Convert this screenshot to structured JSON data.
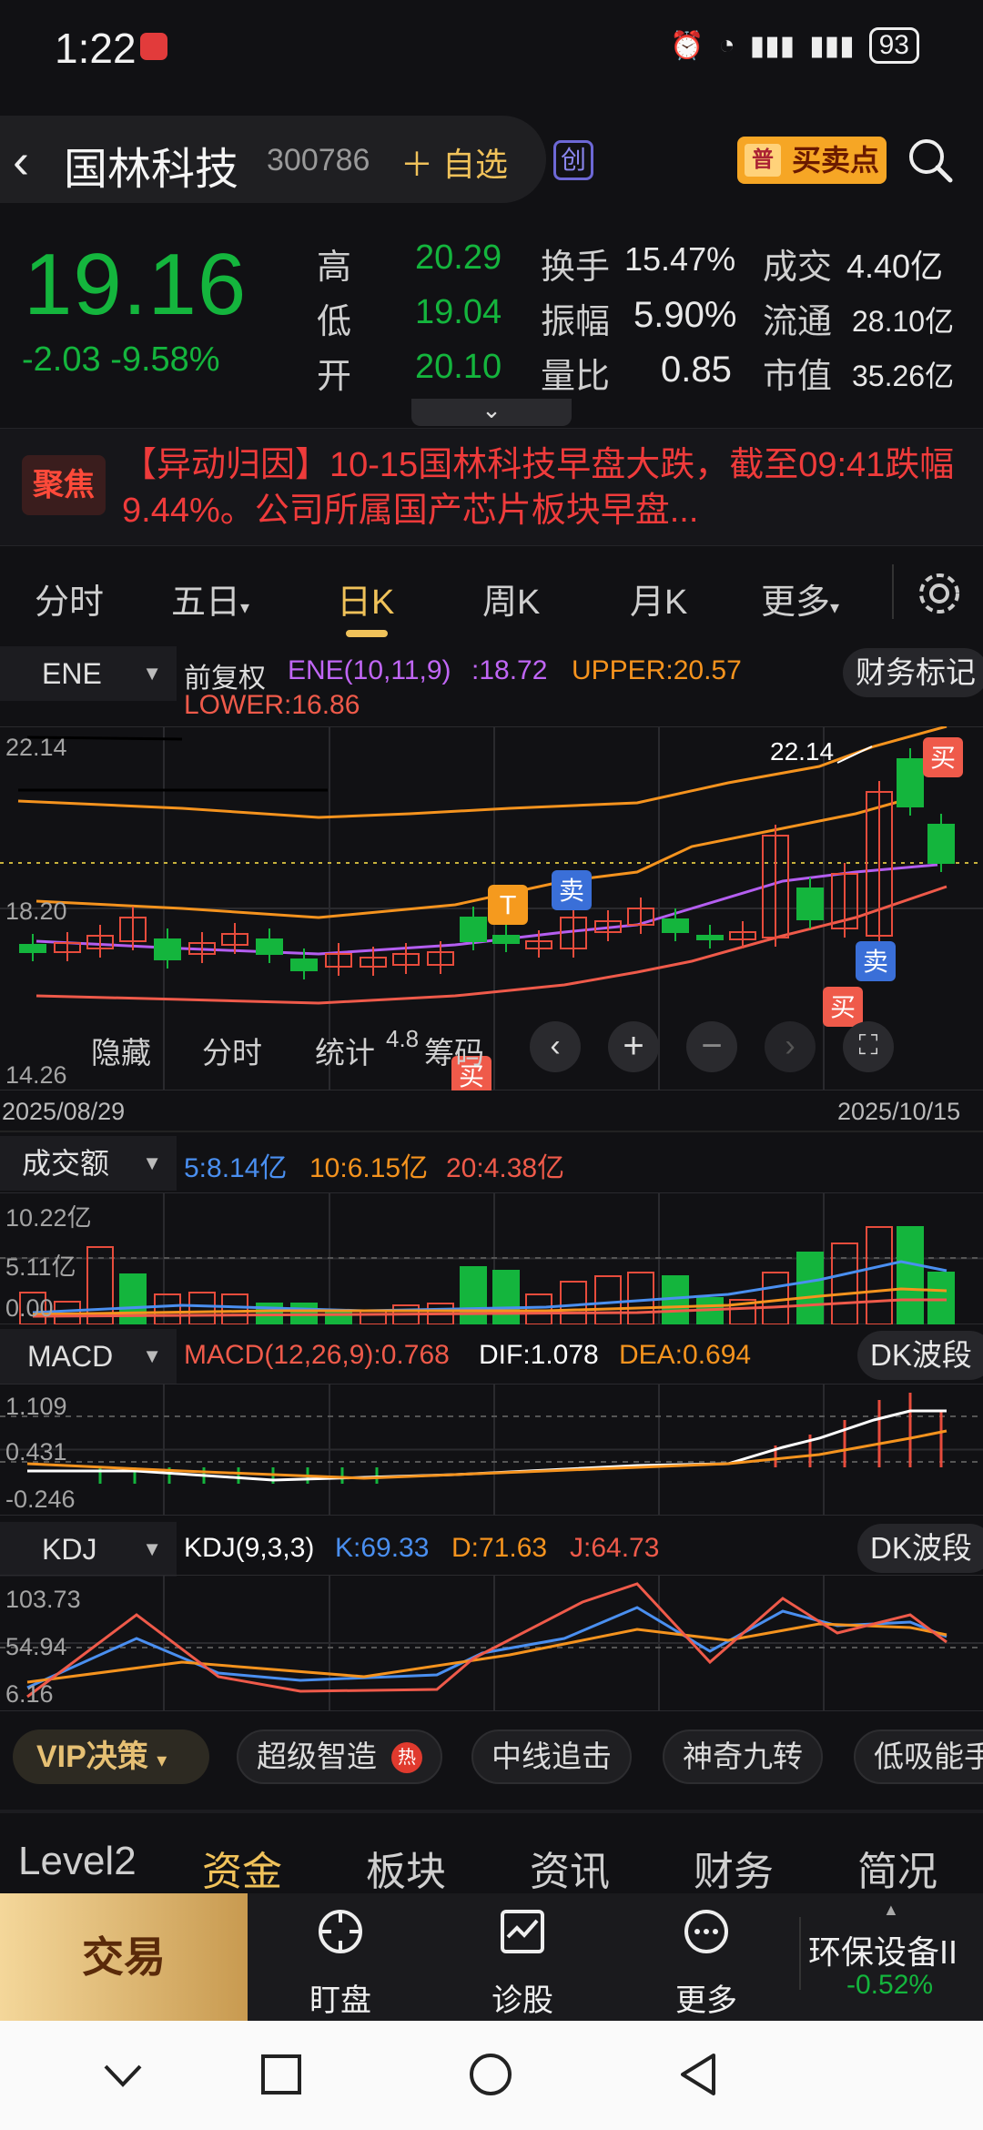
{
  "status_bar": {
    "time": "1:22",
    "battery": "93"
  },
  "header": {
    "stock_name": "国林科技",
    "stock_code": "300786",
    "add_favorite": "自选",
    "board_badge": "创",
    "buy_sell_points": "买卖点",
    "buy_sell_badge": "普"
  },
  "quote": {
    "price": "19.16",
    "change": "-2.03",
    "change_pct": "-9.58%",
    "high_label": "高",
    "high": "20.29",
    "low_label": "低",
    "low": "19.04",
    "open_label": "开",
    "open": "20.10",
    "turnover_label": "换手",
    "turnover": "15.47%",
    "amplitude_label": "振幅",
    "amplitude": "5.90%",
    "volume_ratio_label": "量比",
    "volume_ratio": "0.85",
    "deal_label": "成交",
    "deal": "4.40亿",
    "float_label": "流通",
    "float_cap": "28.10亿",
    "mcap_label": "市值",
    "market_cap": "35.26亿"
  },
  "news": {
    "badge": "聚焦",
    "text": "【异动归因】10-15国林科技早盘大跌，截至09:41跌幅9.44%。公司所属国产芯片板块早盘..."
  },
  "period_tabs": [
    {
      "label": "分时"
    },
    {
      "label": "五日"
    },
    {
      "label": "日K"
    },
    {
      "label": "周K"
    },
    {
      "label": "月K"
    },
    {
      "label": "更多"
    }
  ],
  "main_chart": {
    "indicator": "ENE",
    "adjust": "前复权",
    "ene": "ENE(10,11,9)",
    "ene_value": ":18.72",
    "upper": "UPPER:20.57",
    "lower": "LOWER:16.86",
    "finance_mark": "财务标记",
    "y_top": "22.14",
    "y_mid": "18.20",
    "y_bot": "14.26",
    "x_start": "2025/08/29",
    "x_end": "2025/10/15",
    "high_label": "22.14",
    "low_label": "4.8",
    "tools": {
      "hide": "隐藏",
      "intraday": "分时",
      "stats": "统计",
      "chips": "筹码"
    },
    "signals": {
      "buy": "买",
      "sell": "卖",
      "t": "T"
    }
  },
  "volume_panel": {
    "indicator": "成交额",
    "ma5": "5:8.14亿",
    "ma10": "10:6.15亿",
    "ma20": "20:4.38亿",
    "y_top": "10.22亿",
    "y_mid": "5.11亿",
    "y_bot": "0.00"
  },
  "macd_panel": {
    "indicator": "MACD",
    "macd": "MACD(12,26,9):0.768",
    "dif": "DIF:1.078",
    "dea": "DEA:0.694",
    "dk": "DK波段",
    "y_top": "1.109",
    "y_mid": "0.431",
    "y_bot": "-0.246"
  },
  "kdj_panel": {
    "indicator": "KDJ",
    "kdj": "KDJ(9,3,3)",
    "k": "K:69.33",
    "d": "D:71.63",
    "j": "J:64.73",
    "dk": "DK波段",
    "y_top": "103.73",
    "y_mid": "54.94",
    "y_bot": "6.16"
  },
  "strategy_bar": {
    "vip": "VIP决策",
    "chips": [
      "超级智造",
      "中线追击",
      "神奇九转",
      "低吸能手"
    ],
    "hot": "热"
  },
  "bottom_tabs": [
    {
      "label": "Level2"
    },
    {
      "label": "资金"
    },
    {
      "label": "板块"
    },
    {
      "label": "资讯"
    },
    {
      "label": "财务"
    },
    {
      "label": "简况"
    }
  ],
  "nav": {
    "trade": "交易",
    "watch": "盯盘",
    "diagnose": "诊股",
    "more": "更多",
    "sector": "环保设备II",
    "sector_change": "-0.52%"
  },
  "colors": {
    "up": "#e74c3c",
    "down": "#14b53d",
    "accent": "#f0c25a",
    "ma_orange": "#f5931e",
    "ma_purple": "#b45ef0",
    "blue": "#4a7fe0"
  }
}
